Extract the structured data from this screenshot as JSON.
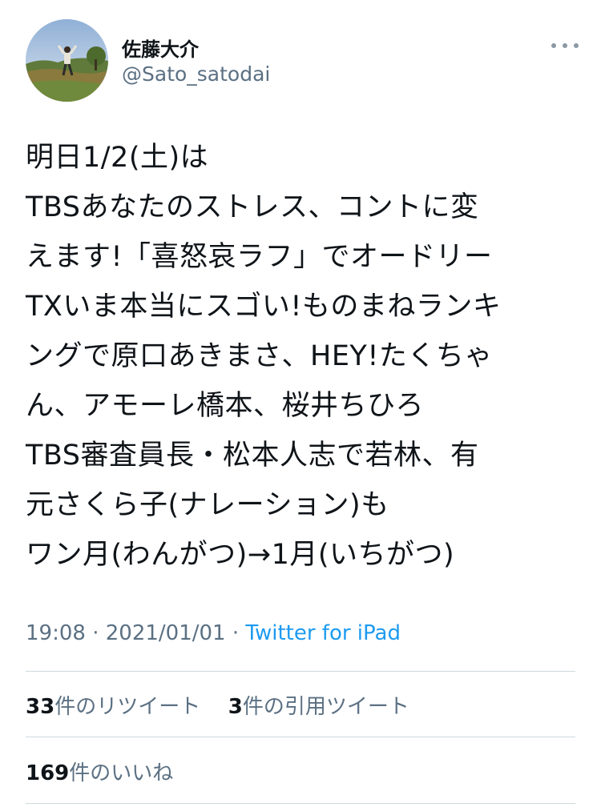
{
  "user": {
    "display_name": "佐藤大介",
    "handle": "@Sato_satodai",
    "avatar_icon": "profile-photo"
  },
  "tweet": {
    "lines": [
      "明日1/2(土)は",
      "TBSあなたのストレス、コントに変",
      "えます!「喜怒哀ラフ」でオードリー",
      "TXいま本当にスゴい!ものまねランキ",
      "ングで原口あきまさ、HEY!たくちゃ",
      "ん、アモーレ橋本、桜井ちひろ",
      "TBS審査員長・松本人志で若林、有",
      "元さくら子(ナレーション)も",
      "ワン月(わんがつ)→1月(いちがつ)"
    ],
    "time": "19:08",
    "separator": "·",
    "date": "2021/01/01",
    "source": "Twitter for iPad"
  },
  "stats": {
    "retweets_count": "33",
    "retweets_label": "件のリツイート",
    "quotes_count": "3",
    "quotes_label": "件の引用ツイート",
    "likes_count": "169",
    "likes_label": "件のいいね"
  },
  "colors": {
    "text": "#0f1419",
    "secondary": "#5b7083",
    "link": "#1d9bf0",
    "divider": "#cfd9de"
  }
}
